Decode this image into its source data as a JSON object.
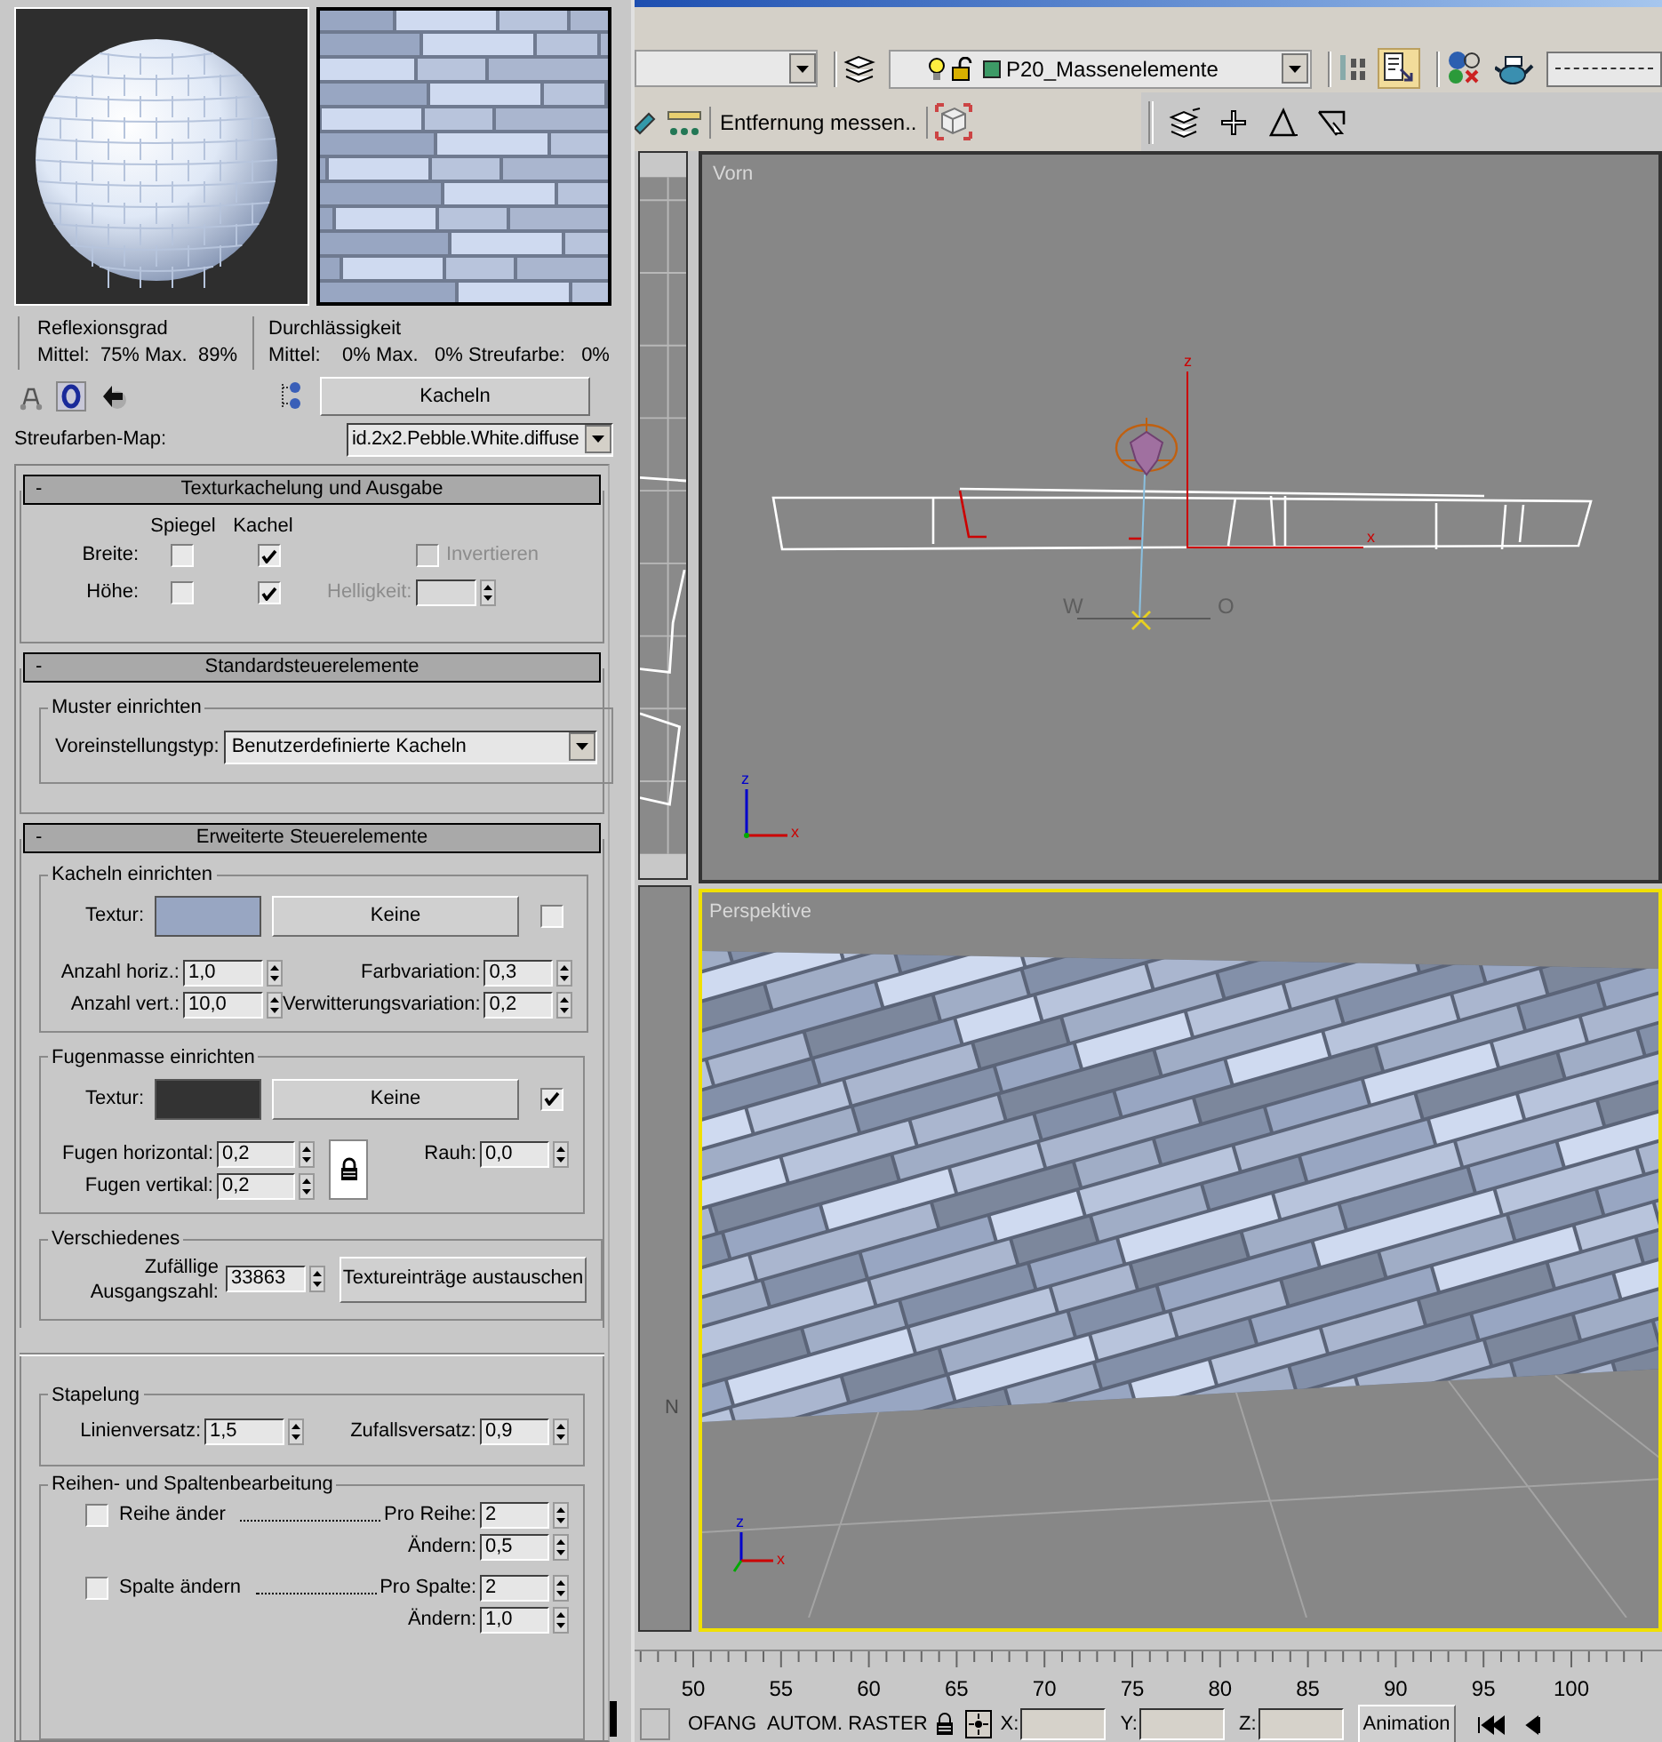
{
  "material": {
    "reflection": {
      "label": "Reflexionsgrad",
      "values": "Mittel:  75% Max.  89%"
    },
    "transparency": {
      "label": "Durchlässigkeit",
      "values": "Mittel:    0% Max.   0% Streufarbe:   0%"
    },
    "type_button": "Kacheln",
    "map_label": "Streufarben-Map:",
    "map_value": "id.2x2.Pebble.White.diffuse"
  },
  "rollouts": [
    {
      "toggle": "-",
      "title": "Texturkachelung und Ausgabe"
    },
    {
      "toggle": "-",
      "title": "Standardsteuerelemente"
    },
    {
      "toggle": "-",
      "title": "Erweiterte Steuerelemente"
    }
  ],
  "tiling": {
    "mirror_header": "Spiegel",
    "tile_header": "Kachel",
    "rows": [
      {
        "label": "Breite:",
        "mirror": false,
        "tile": true
      },
      {
        "label": "Höhe:",
        "mirror": false,
        "tile": true
      }
    ],
    "invert": {
      "label": "Invertieren",
      "checked": false,
      "disabled": true
    },
    "brightness": {
      "label": "Helligkeit:",
      "disabled": true
    }
  },
  "standard": {
    "group": "Muster einrichten",
    "preset_label": "Voreinstellungstyp:",
    "preset_value": "Benutzerdefinierte Kacheln"
  },
  "tiles": {
    "group": "Kacheln einrichten",
    "texture_label": "Textur:",
    "color": "#98a6c2",
    "map_button": "Keine",
    "checked": false,
    "left_spinners": [
      {
        "label": "Anzahl horiz.:",
        "value": "1,0"
      },
      {
        "label": "Anzahl vert.:",
        "value": "10,0"
      }
    ],
    "right_spinners": [
      {
        "label": "Farbvariation:",
        "value": "0,3"
      },
      {
        "label": "Verwitterungsvariation:",
        "value": "0,2"
      }
    ]
  },
  "grout": {
    "group": "Fugenmasse einrichten",
    "texture_label": "Textur:",
    "color": "#333333",
    "map_button": "Keine",
    "checked": true,
    "left_spinners": [
      {
        "label": "Fugen horizontal:",
        "value": "0,2"
      },
      {
        "label": "Fugen vertikal:",
        "value": "0,2"
      }
    ],
    "right_spinners": [
      {
        "label": "Rauh:",
        "value": "0,0"
      }
    ]
  },
  "misc": {
    "group": "Verschiedenes",
    "seed_label": "Zufällige Ausgangszahl:",
    "seed_value": "33863",
    "swap_button": "Textureinträge austauschen"
  },
  "stacking": {
    "group": "Stapelung",
    "spinners": [
      {
        "label": "Linienversatz:",
        "value": "1,5"
      },
      {
        "label": "Zufallsversatz:",
        "value": "0,9"
      }
    ]
  },
  "row_column": {
    "group": "Reihen- und Spaltenbearbeitung",
    "items": [
      {
        "label": "Reihe änder",
        "checked": false,
        "spinners": [
          {
            "label": "Pro Reihe:",
            "value": "2"
          },
          {
            "label": "Ändern:",
            "value": "0,5"
          }
        ]
      },
      {
        "label": "Spalte ändern",
        "checked": false,
        "spinners": [
          {
            "label": "Pro Spalte:",
            "value": "2"
          },
          {
            "label": "Ändern:",
            "value": "1,0"
          }
        ]
      }
    ]
  },
  "toolbar": {
    "layer": "P20_Massenelemente",
    "measure_button": "Entfernung messen.."
  },
  "viewports": [
    {
      "label": "Vorn",
      "selected": false,
      "compass": [
        "W",
        "O"
      ],
      "gizmo_axes": [
        "z",
        "x"
      ],
      "tripod_axes": [
        "z",
        "x"
      ]
    },
    {
      "label": "Perspektive",
      "selected": true,
      "tripod_axes": [
        "z",
        "x"
      ]
    }
  ],
  "side_strip_label": "N",
  "timeline": {
    "labels": [
      "50",
      "55",
      "60",
      "65",
      "70",
      "75",
      "80",
      "85",
      "90",
      "95",
      "100"
    ]
  },
  "status_bar": {
    "snap": "OFANG",
    "grid": "AUTOM. RASTER",
    "coords": [
      "X:",
      "Y:",
      "Z:"
    ],
    "animation_button": "Animation"
  }
}
